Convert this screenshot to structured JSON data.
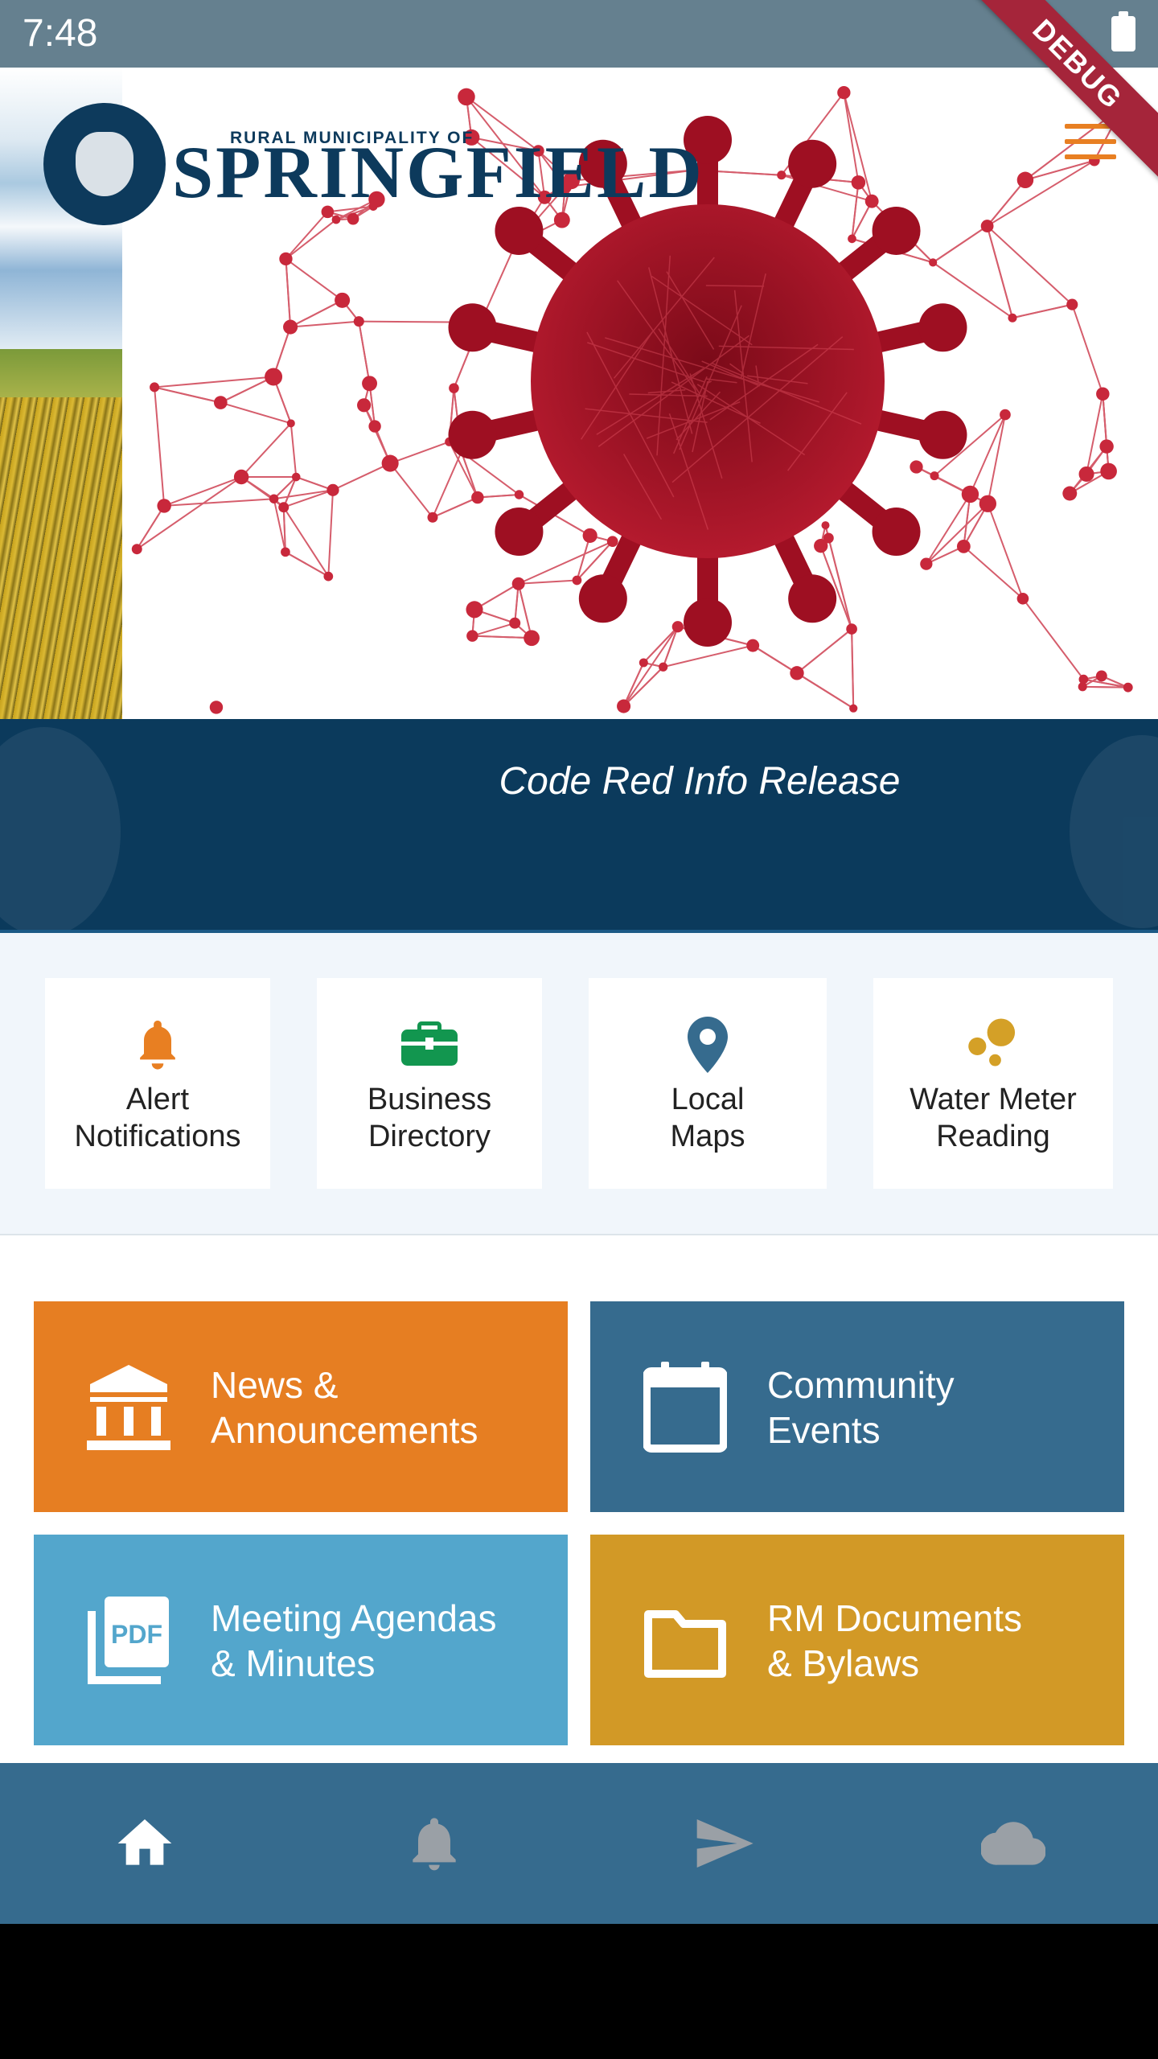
{
  "status_bar": {
    "time": "7:48",
    "debug_label": "DEBUG"
  },
  "header": {
    "logo_small": "RURAL MUNICIPALITY OF",
    "logo_big": "SPRINGFIELD",
    "menu_icon": "hamburger-menu-icon"
  },
  "banner": {
    "title": "Code Red Info Release"
  },
  "quick_links": [
    {
      "label_line1": "Alert",
      "label_line2": "Notifications",
      "icon": "bell-icon",
      "color": "#e87f22"
    },
    {
      "label_line1": "Business",
      "label_line2": "Directory",
      "icon": "briefcase-icon",
      "color": "#12964f"
    },
    {
      "label_line1": "Local",
      "label_line2": "Maps",
      "icon": "map-pin-icon",
      "color": "#366b8e"
    },
    {
      "label_line1": "Water Meter",
      "label_line2": "Reading",
      "icon": "bubbles-icon",
      "color": "#d4a027"
    }
  ],
  "tiles": [
    {
      "line1": "News &",
      "line2": "Announcements",
      "icon": "bank-icon",
      "color": "#e67e22"
    },
    {
      "line1": "Community",
      "line2": "Events",
      "icon": "calendar-icon",
      "color": "#366b8e"
    },
    {
      "line1": "Meeting Agendas",
      "line2": "& Minutes",
      "icon": "pdf-icon",
      "icon_text": "PDF",
      "color": "#53a6cc"
    },
    {
      "line1": "RM Documents",
      "line2": "& Bylaws",
      "icon": "folder-icon",
      "color": "#d29926"
    }
  ],
  "bottom_nav": [
    {
      "icon": "home-icon",
      "active": true
    },
    {
      "icon": "bell-icon",
      "active": false
    },
    {
      "icon": "send-icon",
      "active": false
    },
    {
      "icon": "cloud-icon",
      "active": false
    }
  ],
  "colors": {
    "status_bar": "#65808f",
    "banner": "#0b3a5c",
    "nav": "#366b8e",
    "nav_active": "#ffffff",
    "nav_inactive": "#9aa0a6",
    "virus": "#9e0f22"
  }
}
